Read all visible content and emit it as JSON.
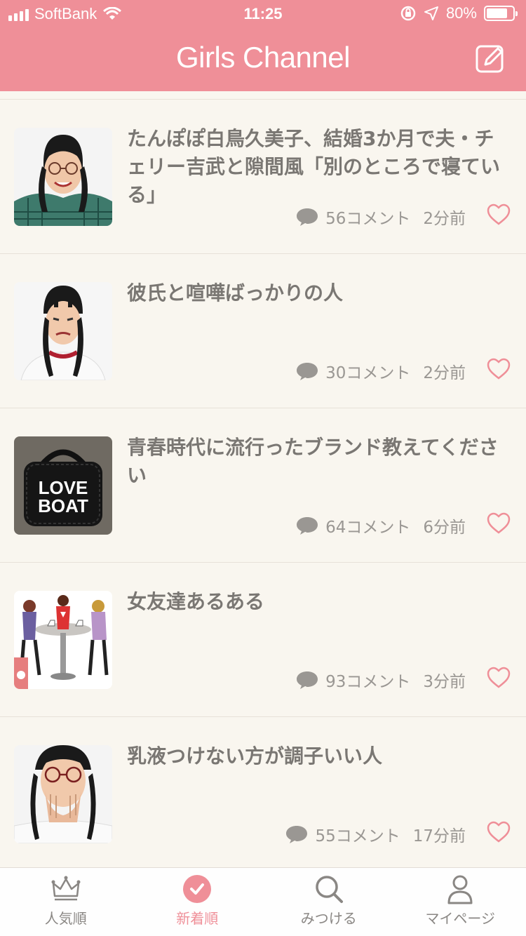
{
  "status_bar": {
    "carrier": "SoftBank",
    "time": "11:25",
    "battery": "80%",
    "battery_level": 0.8
  },
  "header": {
    "title": "Girls Channel",
    "compose_icon": "compose-icon"
  },
  "feed": {
    "items": [
      {
        "title": "たんぽぽ白鳥久美子、結婚3か月で夫・チェリー吉武と隙間風「別のところで寝ている」",
        "comments": "56コメント",
        "time": "2分前",
        "thumb": "woman-glasses-braids-photo"
      },
      {
        "title": "彼氏と喧嘩ばっかりの人",
        "comments": "30コメント",
        "time": "2分前",
        "thumb": "woman-braids-grimace-photo"
      },
      {
        "title": "青春時代に流行ったブランド教えてください",
        "comments": "64コメント",
        "time": "6分前",
        "thumb": "love-boat-bag-photo",
        "thumb_text": "LOVE BOAT"
      },
      {
        "title": "女友達あるある",
        "comments": "93コメント",
        "time": "3分前",
        "thumb": "women-cafe-illustration"
      },
      {
        "title": "乳液つけない方が調子いい人",
        "comments": "55コメント",
        "time": "17分前",
        "thumb": "woman-glasses-hand-face-photo"
      }
    ]
  },
  "tabbar": {
    "tabs": [
      {
        "label": "人気順",
        "icon": "crown-icon",
        "active": false
      },
      {
        "label": "新着順",
        "icon": "check-circle-icon",
        "active": true
      },
      {
        "label": "みつける",
        "icon": "search-icon",
        "active": false
      },
      {
        "label": "マイページ",
        "icon": "person-icon",
        "active": false
      }
    ]
  },
  "colors": {
    "brand": "#ef8f98",
    "background": "#f9f6ef",
    "text": "#7a7773",
    "meta": "#9a9793"
  }
}
